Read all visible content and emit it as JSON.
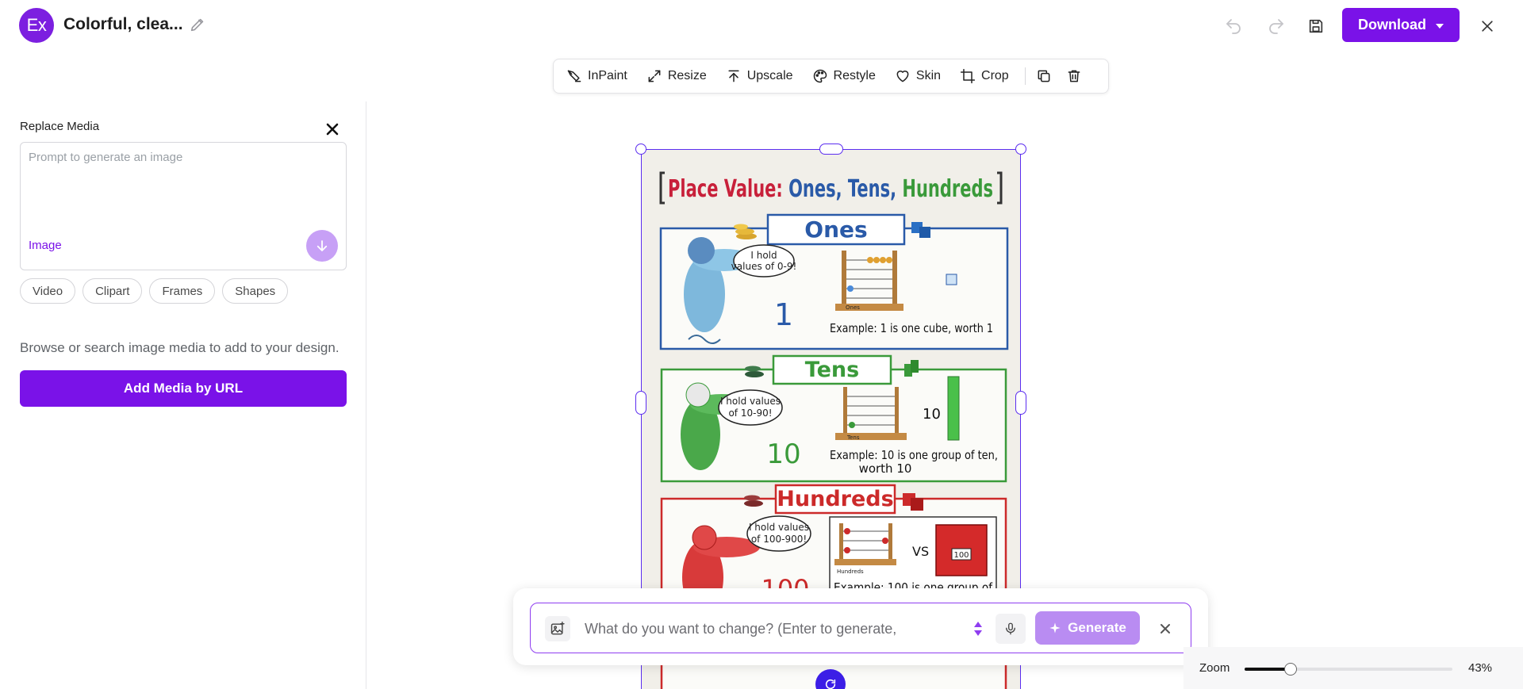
{
  "header": {
    "logo_text": "Ex",
    "title": "Colorful, clea...",
    "download_label": "Download",
    "colors": {
      "brand": "#7a12e8",
      "logo": "#7c1fe0"
    }
  },
  "sidebar": {
    "title": "Replace Media",
    "prompt_placeholder": "Prompt to generate an image",
    "prompt_value": "",
    "media_type": "Image",
    "chips": [
      "Video",
      "Clipart",
      "Frames",
      "Shapes"
    ],
    "description": "Browse or search image media to add to your design.",
    "add_url_label": "Add Media by URL"
  },
  "toolbar": {
    "tools": [
      {
        "label": "InPaint",
        "icon": "inpaint-icon"
      },
      {
        "label": "Resize",
        "icon": "resize-icon"
      },
      {
        "label": "Upscale",
        "icon": "upscale-icon"
      },
      {
        "label": "Restyle",
        "icon": "palette-icon"
      },
      {
        "label": "Skin",
        "icon": "heart-icon"
      },
      {
        "label": "Crop",
        "icon": "crop-icon"
      }
    ],
    "extra_icons": [
      "duplicate-icon",
      "trash-icon"
    ]
  },
  "poster": {
    "title_parts": [
      "Place Value:",
      "Ones,",
      "Tens,",
      "Hundreds"
    ],
    "colors": {
      "ones": "#2a5aa8",
      "tens": "#3a9a3a",
      "hundreds": "#cc2a2a",
      "title_red": "#c8203a"
    },
    "sections": [
      {
        "heading": "Ones",
        "bubble_line1": "I hold",
        "bubble_line2": "values of 0-9!",
        "number": "1",
        "abacus_label": "Ones",
        "example": "Example: 1 is one cube, worth 1",
        "example_line2": ""
      },
      {
        "heading": "Tens",
        "bubble_line1": "I hold values",
        "bubble_line2": "of 10-90!",
        "number": "10",
        "abacus_label": "Tens",
        "side_number": "10",
        "example": "Example: 10 is one group of ten,",
        "example_line2": "worth 10"
      },
      {
        "heading": "Hundreds",
        "bubble_line1": "I hold values",
        "bubble_line2": "of 100-900!",
        "number": "100",
        "abacus_label": "Hundreds",
        "vs_text": "VS",
        "block_label": "100",
        "example": "Example: 100 is one group of",
        "example_line2": ""
      }
    ]
  },
  "ai_prompt": {
    "placeholder": "What do you want to change? (Enter to generate,",
    "value": "",
    "generate_label": "Generate"
  },
  "zoom": {
    "label": "Zoom",
    "value_text": "43%",
    "level": 0.43
  }
}
